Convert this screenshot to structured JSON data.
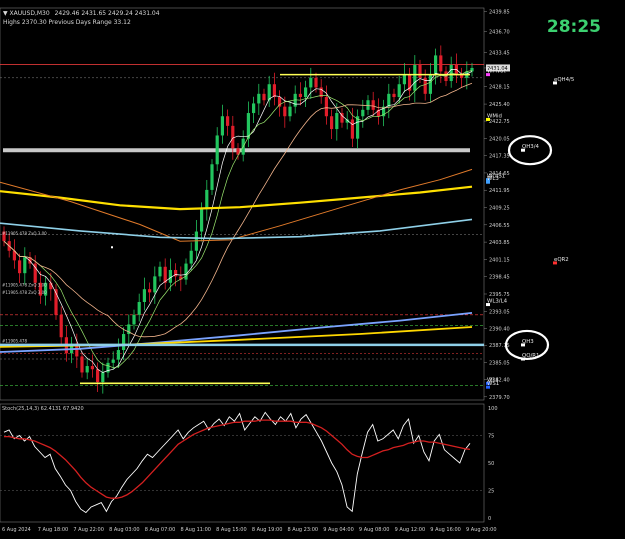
{
  "header": {
    "symbol_line": "▼ XAUUSD,M30",
    "prices_line": "2429.46 2431.65 2429.24 2431.04",
    "stats_line": "Highs 2370.30   Previous Days Range 33.12"
  },
  "timer": "28:25",
  "colors": {
    "background": "#000000",
    "bull": "#22c55e",
    "bear": "#e11d2a",
    "pivot_yellow": "#ffff55",
    "white_zone": "#c8c8c8",
    "light_blue": "#8fd0e8",
    "ma_blue": "#7aa3ff",
    "stoch_main": "#ffffff",
    "stoch_signal": "#d42020",
    "timer": "#3cd070"
  },
  "chart_data": [
    {
      "type": "candlestick",
      "symbol": "XAUUSD",
      "timeframe": "M30",
      "ylim": [
        2379.2,
        2440.4
      ],
      "y_ticks": [
        "2439.85",
        "2436.70",
        "2433.45",
        "2431.04",
        "2428.15",
        "2425.40",
        "2422.75",
        "2420.05",
        "2417.35",
        "2414.65",
        "2411.95",
        "2409.25",
        "2406.55",
        "2403.85",
        "2401.15",
        "2398.45",
        "2395.75",
        "2393.05",
        "2390.40",
        "2387.75",
        "2385.05",
        "2382.40",
        "2379.70"
      ],
      "current_price": "2431.04",
      "x_ticks": [
        "6 Aug 2024",
        "7 Aug 18:00",
        "7 Aug 22:00",
        "8 Aug 03:00",
        "8 Aug 07:00",
        "8 Aug 11:00",
        "8 Aug 15:00",
        "8 Aug 19:00",
        "8 Aug 23:00",
        "9 Aug 04:00",
        "9 Aug 08:00",
        "9 Aug 12:00",
        "9 Aug 16:00",
        "9 Aug 20:00"
      ],
      "closes": [
        2404.0,
        2402.5,
        2401.0,
        2399.0,
        2401.5,
        2400.5,
        2397.5,
        2395.5,
        2397.5,
        2396.5,
        2392.5,
        2389.0,
        2386.5,
        2388.0,
        2386.0,
        2383.5,
        2384.5,
        2384.0,
        2382.0,
        2383.5,
        2385.0,
        2385.5,
        2387.0,
        2389.5,
        2391.0,
        2392.5,
        2394.5,
        2396.5,
        2396.0,
        2398.5,
        2400.0,
        2397.5,
        2399.5,
        2398.5,
        2398.0,
        2400.5,
        2402.5,
        2405.5,
        2409.0,
        2412.0,
        2416.0,
        2420.5,
        2423.5,
        2422.0,
        2418.5,
        2417.5,
        2420.0,
        2424.0,
        2425.5,
        2427.0,
        2426.0,
        2428.5,
        2426.5,
        2425.0,
        2423.5,
        2425.0,
        2427.0,
        2426.5,
        2428.0,
        2429.5,
        2428.0,
        2426.5,
        2423.5,
        2421.5,
        2424.0,
        2422.5,
        2423.0,
        2420.0,
        2423.5,
        2424.5,
        2426.0,
        2424.5,
        2423.5,
        2425.0,
        2427.0,
        2426.5,
        2428.5,
        2430.0,
        2427.5,
        2431.5,
        2429.5,
        2427.0,
        2430.0,
        2433.0,
        2430.5,
        2429.0,
        2431.5,
        2430.0,
        2429.5,
        2430.5,
        2431.04
      ],
      "levels": [
        {
          "label": "WPivot",
          "value": 2430.0
        },
        {
          "label": "eQH4/5",
          "value": 2428.7
        },
        {
          "label": "WMid",
          "value": 2423.0
        },
        {
          "label": "QH3/4",
          "value": 2418.2
        },
        {
          "label": "WO/S1",
          "value": 2413.6
        },
        {
          "label": "WL3",
          "value": 2413.2
        },
        {
          "label": "eQR2",
          "value": 2400.6
        },
        {
          "label": "WL3/L4",
          "value": 2394.1
        },
        {
          "label": "QH3",
          "value": 2387.8
        },
        {
          "label": "QO/R1",
          "value": 2385.6
        },
        {
          "label": "WL4",
          "value": 2381.8
        },
        {
          "label": "WS1",
          "value": 2381.2
        }
      ],
      "left_zone_labels": [
        "#11905.478 ZxQ 3.00",
        "#11905.478 ZxQ 3.00",
        "#11905.478 ZxQ 3.00",
        "#11905.478"
      ]
    },
    {
      "type": "line",
      "title": "Stoch(25,14,3) 62.4131 67.9420",
      "ylim": [
        0,
        100
      ],
      "y_ticks": [
        "100",
        "75",
        "50",
        "25",
        "0"
      ],
      "series": [
        {
          "name": "main",
          "values": [
            78,
            80,
            72,
            75,
            70,
            74,
            65,
            60,
            55,
            58,
            45,
            38,
            30,
            25,
            15,
            8,
            5,
            10,
            12,
            14,
            6,
            15,
            20,
            28,
            35,
            40,
            45,
            52,
            58,
            55,
            60,
            65,
            70,
            75,
            80,
            72,
            78,
            82,
            85,
            88,
            80,
            86,
            90,
            84,
            92,
            88,
            95,
            80,
            86,
            92,
            88,
            96,
            90,
            85,
            92,
            88,
            95,
            82,
            90,
            94,
            86,
            78,
            70,
            60,
            50,
            42,
            30,
            10,
            6,
            40,
            60,
            78,
            85,
            70,
            72,
            76,
            80,
            72,
            84,
            90,
            68,
            75,
            60,
            52,
            70,
            76,
            62,
            58,
            54,
            50,
            62,
            67.9
          ]
        },
        {
          "name": "signal",
          "values": [
            74,
            74,
            73,
            72,
            72,
            71,
            70,
            68,
            66,
            64,
            61,
            57,
            53,
            48,
            43,
            37,
            32,
            28,
            25,
            22,
            19,
            18,
            18,
            19,
            21,
            24,
            28,
            32,
            37,
            42,
            47,
            52,
            57,
            62,
            67,
            70,
            73,
            76,
            78,
            80,
            82,
            83,
            84,
            85,
            86,
            87,
            87,
            88,
            88,
            88,
            89,
            89,
            89,
            88,
            88,
            88,
            88,
            87,
            87,
            87,
            86,
            84,
            82,
            79,
            75,
            71,
            67,
            62,
            58,
            56,
            55,
            55,
            57,
            59,
            61,
            62,
            64,
            65,
            66,
            68,
            69,
            70,
            70,
            69,
            69,
            68,
            67,
            66,
            65,
            64,
            63,
            62.4
          ]
        }
      ]
    }
  ]
}
